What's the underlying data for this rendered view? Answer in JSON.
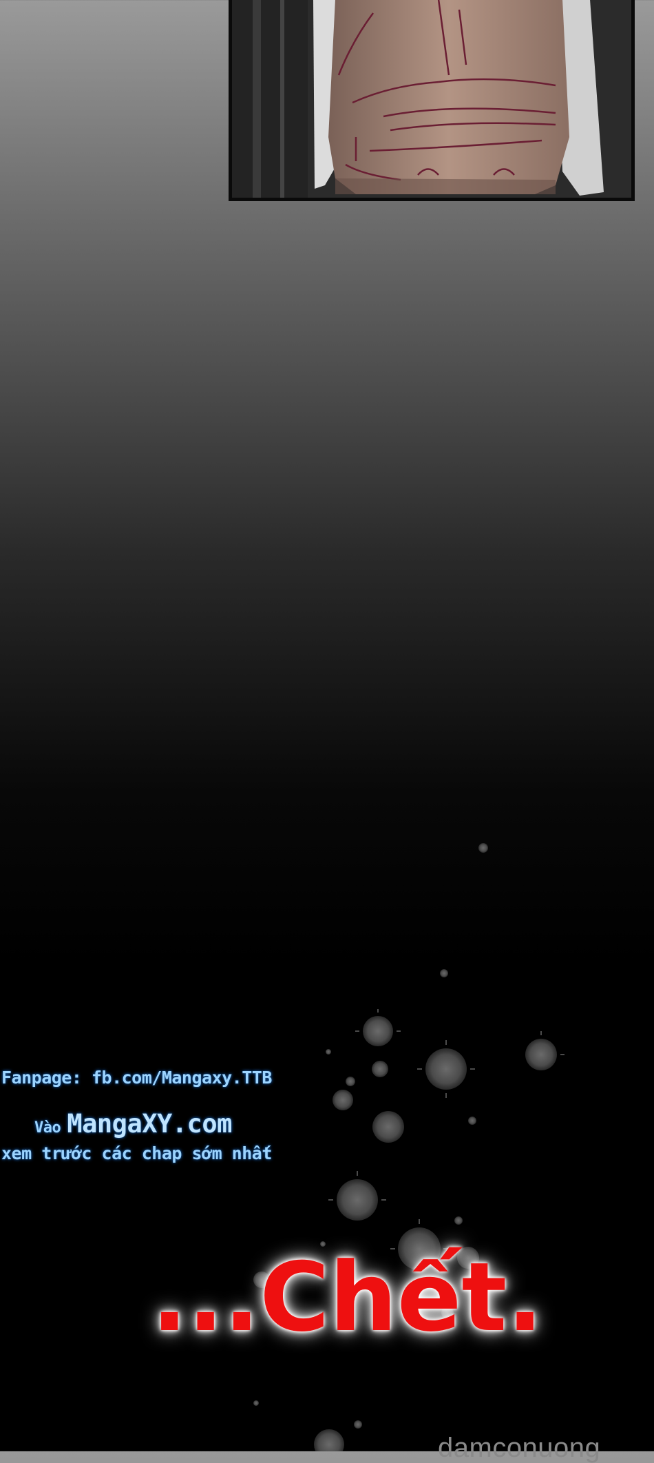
{
  "fanpage": "Fanpage: fb.com/Mangaxy.TTB",
  "visit_prefix": "Vào",
  "site": "MangaXY.com",
  "preview": "xem trước các chap sớm nhất",
  "sfx": "...Chết.",
  "watermark": "damconuong",
  "colors": {
    "sfx_red": "#ee1010",
    "ad_blue": "#9cd4ff",
    "background_bottom": "#000000"
  },
  "icons": [
    "blood-splatter-icon"
  ]
}
